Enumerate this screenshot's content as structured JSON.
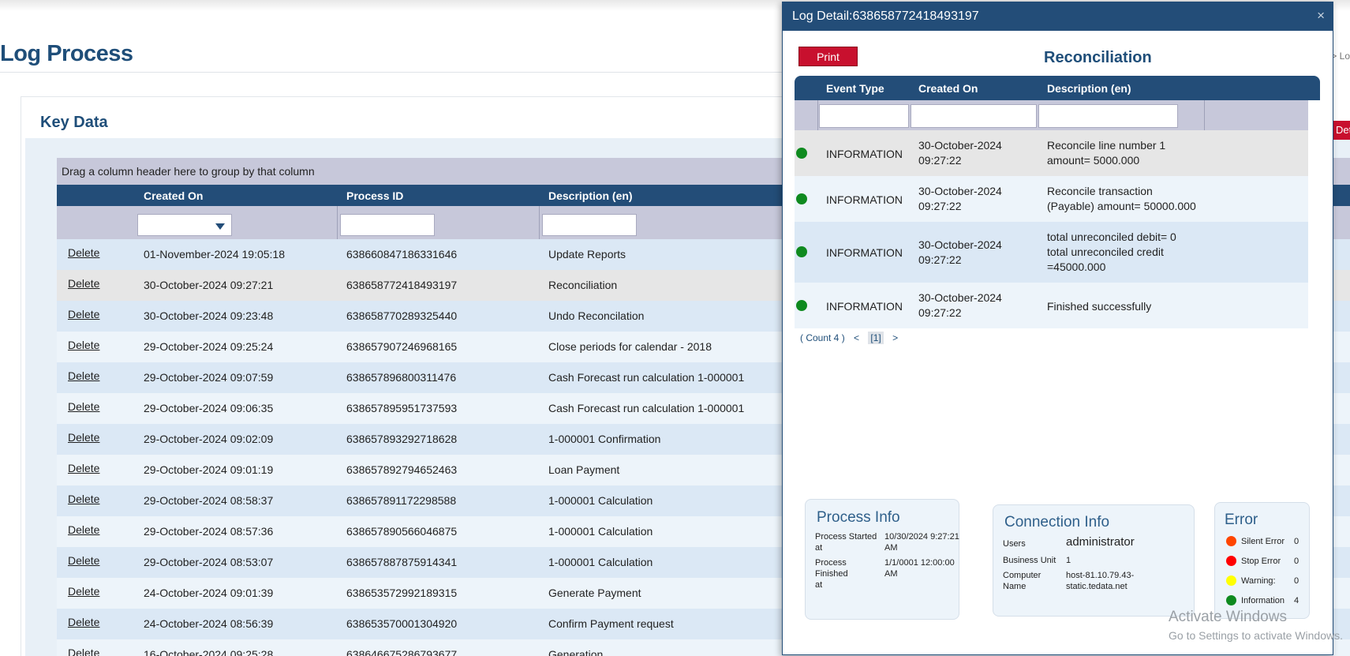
{
  "page": {
    "title": "Log Process",
    "breadcrumb": "> Lo",
    "card_title": "Key Data",
    "right_button": "Det"
  },
  "grid": {
    "group_hint": "Drag a column header here to group by that column",
    "columns": [
      "Created On",
      "Process ID",
      "Description (en)"
    ],
    "delete_label": "Delete",
    "rows": [
      {
        "created": "01-November-2024 19:05:18",
        "pid": "638660847186331646",
        "desc": "Update Reports"
      },
      {
        "created": "30-October-2024 09:27:21",
        "pid": "638658772418493197",
        "desc": "Reconciliation"
      },
      {
        "created": "30-October-2024 09:23:48",
        "pid": "638658770289325440",
        "desc": "Undo Reconcilation"
      },
      {
        "created": "29-October-2024 09:25:24",
        "pid": "638657907246968165",
        "desc": "Close periods for calendar - 2018"
      },
      {
        "created": "29-October-2024 09:07:59",
        "pid": "638657896800311476",
        "desc": "Cash Forecast run calculation 1-000001"
      },
      {
        "created": "29-October-2024 09:06:35",
        "pid": "638657895951737593",
        "desc": "Cash Forecast run calculation 1-000001"
      },
      {
        "created": "29-October-2024 09:02:09",
        "pid": "638657893292718628",
        "desc": "1-000001 Confirmation"
      },
      {
        "created": "29-October-2024 09:01:19",
        "pid": "638657892794652463",
        "desc": "Loan Payment"
      },
      {
        "created": "29-October-2024 08:58:37",
        "pid": "638657891172298588",
        "desc": "1-000001 Calculation"
      },
      {
        "created": "29-October-2024 08:57:36",
        "pid": "638657890566046875",
        "desc": "1-000001 Calculation"
      },
      {
        "created": "29-October-2024 08:53:07",
        "pid": "638657887875914341",
        "desc": "1-000001 Calculation"
      },
      {
        "created": "24-October-2024 09:01:39",
        "pid": "638653572992189315",
        "desc": "Generate Payment"
      },
      {
        "created": "24-October-2024 08:56:39",
        "pid": "638653570001304920",
        "desc": "Confirm Payment request"
      },
      {
        "created": "16-October-2024 09:25:28",
        "pid": "638646675286793677",
        "desc": "Generation"
      }
    ]
  },
  "modal": {
    "title": "Log Detail:638658772418493197",
    "close": "×",
    "print_label": "Print",
    "subtitle": "Reconciliation",
    "columns": [
      "Event Type",
      "Created On",
      "Description (en)"
    ],
    "rows": [
      {
        "type": "INFORMATION",
        "created": [
          "30-October-2024",
          "09:27:22"
        ],
        "desc": [
          "Reconcile line number 1",
          "amount= 5000.000"
        ]
      },
      {
        "type": "INFORMATION",
        "created": [
          "30-October-2024",
          "09:27:22"
        ],
        "desc": [
          "Reconcile transaction",
          "(Payable) amount= 50000.000"
        ]
      },
      {
        "type": "INFORMATION",
        "created": [
          "30-October-2024",
          "09:27:22"
        ],
        "desc": [
          "total unreconciled debit= 0",
          "total unreconciled credit",
          "=45000.000"
        ]
      },
      {
        "type": "INFORMATION",
        "created": [
          "30-October-2024",
          "09:27:22"
        ],
        "desc": [
          "Finished successfully"
        ]
      }
    ],
    "pager": {
      "count": "( Count 4 )",
      "prev": "<",
      "page": "[1]",
      "next": ">"
    },
    "process_info": {
      "title": "Process Info",
      "started_label": [
        "Process Started",
        "at"
      ],
      "started_value": [
        "10/30/2024 9:27:21",
        "AM"
      ],
      "finished_label": [
        "Process Finished",
        "at"
      ],
      "finished_value": [
        "1/1/0001 12:00:00",
        "AM"
      ]
    },
    "connection_info": {
      "title": "Connection Info",
      "users_label": "Users",
      "users_value": "administrator",
      "bu_label": "Business Unit",
      "bu_value": "1",
      "computer_label": [
        "Computer",
        "Name"
      ],
      "computer_value": [
        "host-81.10.79.43-",
        "static.tedata.net"
      ]
    },
    "error": {
      "title": "Error",
      "items": [
        {
          "label": "Silent Error",
          "count": "0",
          "color": "#ff4500"
        },
        {
          "label": "Stop Error",
          "count": "0",
          "color": "#ff0000"
        },
        {
          "label": "Warning:",
          "count": "0",
          "color": "#ffff00"
        },
        {
          "label": "Information",
          "count": "4",
          "color": "#0f8a1f"
        }
      ]
    }
  },
  "watermark": {
    "line1": "Activate Windows",
    "line2": "Go to Settings to activate Windows."
  }
}
